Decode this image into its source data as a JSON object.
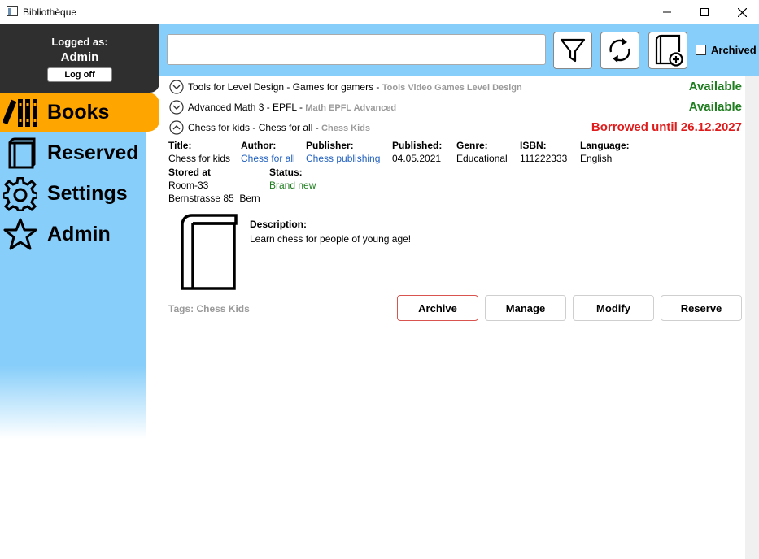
{
  "window": {
    "title": "Bibliothèque"
  },
  "sidebar": {
    "logged_as_label": "Logged as:",
    "user_name": "Admin",
    "logoff_label": "Log off",
    "items": [
      {
        "label": "Books",
        "icon": "books-icon",
        "active": true
      },
      {
        "label": "Reserved",
        "icon": "book-icon"
      },
      {
        "label": "Settings",
        "icon": "gear-icon"
      },
      {
        "label": "Admin",
        "icon": "star-icon"
      }
    ]
  },
  "toolbar": {
    "search_value": "",
    "filter_icon": "filter-icon",
    "refresh_icon": "refresh-icon",
    "add_icon": "add-book-icon",
    "archived_label": "Archived",
    "archived_checked": false
  },
  "books": [
    {
      "title": "Tools for Level Design - Games for gamers - ",
      "tags": "Tools Video Games Level Design",
      "status": "Available",
      "expanded": false
    },
    {
      "title": "Advanced Math 3 - EPFL - ",
      "tags": "Math EPFL Advanced",
      "status": "Available",
      "expanded": false
    },
    {
      "title": "Chess for kids - Chess for all - ",
      "tags": "Chess Kids",
      "status": "Borrowed until 26.12.2027",
      "expanded": true
    }
  ],
  "detail": {
    "labels": {
      "title": "Title:",
      "author": "Author:",
      "publisher": "Publisher:",
      "published": "Published:",
      "genre": "Genre:",
      "isbn": "ISBN:",
      "language": "Language:",
      "stored_at": "Stored at",
      "status": "Status:",
      "description": "Description:"
    },
    "title": "Chess for kids",
    "author": "Chess for all",
    "publisher": "Chess publishing",
    "published": "04.05.2021",
    "genre": "Educational",
    "isbn": "111222333",
    "language": "English",
    "room": "Room-33",
    "address": "Bernstrasse 85  Bern",
    "status": "Brand new",
    "description": "Learn chess for people of young age!",
    "tags_line": "Tags: Chess Kids",
    "buttons": {
      "archive": "Archive",
      "manage": "Manage",
      "modify": "Modify",
      "reserve": "Reserve"
    }
  },
  "colors": {
    "accent_blue": "#87cefa",
    "active_orange": "#ffa500",
    "dark_header": "#2f2f2f",
    "available_green": "#1e7d1e",
    "borrowed_red": "#e01b1b"
  }
}
